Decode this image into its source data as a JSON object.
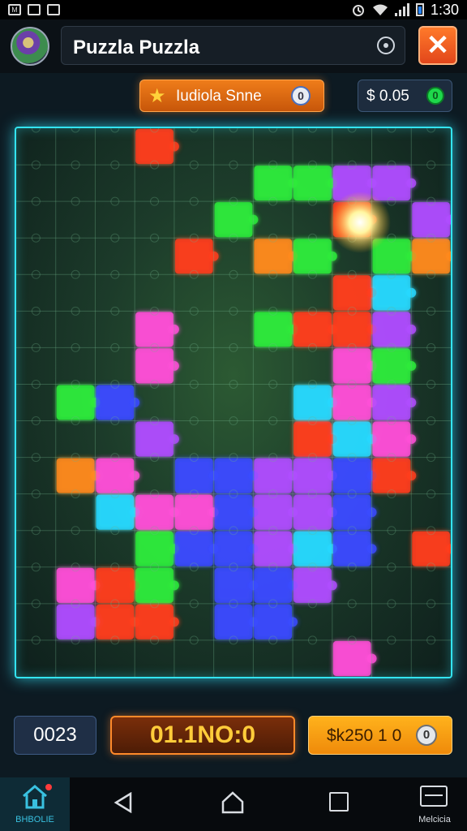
{
  "status_bar": {
    "time": "1:30",
    "left_icons": [
      "m-notification-icon",
      "image-notification-icon",
      "photo-notification-icon"
    ],
    "right_icons": [
      "alarm-icon",
      "wifi-icon",
      "signal-icon",
      "battery-icon"
    ]
  },
  "header": {
    "title": "Puzzla Puzzla",
    "avatar_icon": "frog-avatar-icon",
    "target_icon": "target-icon",
    "close_icon": "close-x-icon"
  },
  "hud": {
    "level_label": "Iudiola Snne",
    "level_icon": "star-icon",
    "level_coin_glyph": "0",
    "money": "$ 0.05",
    "money_icon_glyph": "0"
  },
  "board": {
    "columns": 11,
    "rows": 15,
    "border_color": "#33e4f0",
    "glow_icon": "sparkle-icon"
  },
  "footer_hud": {
    "counter": "0023",
    "score": "01.1NO:0",
    "bonus": "$k250 1 0",
    "bonus_coin_glyph": "0"
  },
  "nav_bar": {
    "home_label": "BHBOLIE",
    "menu_label": "Melcicia",
    "icons": [
      "home-icon",
      "back-icon",
      "home-circle-icon",
      "recent-apps-icon",
      "menu-icon"
    ]
  },
  "colors": {
    "accent_orange": "#ef7d1a",
    "accent_cyan": "#33e4f0",
    "score_gold": "#ffcc3a",
    "piece_palette": [
      "#ff3d1f",
      "#2dea3c",
      "#b04dff",
      "#ff4fd8",
      "#3b4bff",
      "#ff8a1f",
      "#27d9ff"
    ]
  }
}
